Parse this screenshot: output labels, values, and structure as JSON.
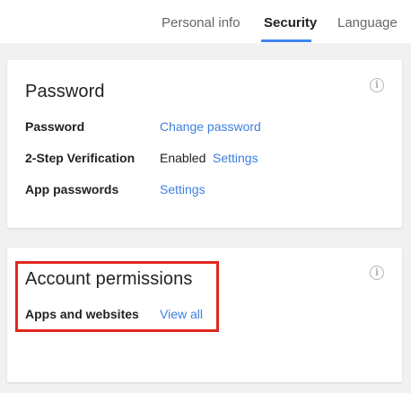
{
  "tabs": [
    {
      "label": "Personal info",
      "active": false
    },
    {
      "label": "Security",
      "active": true
    },
    {
      "label": "Language",
      "active": false
    }
  ],
  "accent_color": "#4285f4",
  "link_color": "#3d7fe0",
  "highlight_color": "#e0281f",
  "password_card": {
    "title": "Password",
    "info_icon": "info-icon",
    "rows": [
      {
        "label": "Password",
        "value": "",
        "link": "Change password"
      },
      {
        "label": "2-Step Verification",
        "value": "Enabled",
        "link": "Settings"
      },
      {
        "label": "App passwords",
        "value": "",
        "link": "Settings"
      }
    ]
  },
  "permissions_card": {
    "title": "Account permissions",
    "info_icon": "info-icon",
    "rows": [
      {
        "label": "Apps and websites",
        "link": "View all"
      }
    ]
  }
}
